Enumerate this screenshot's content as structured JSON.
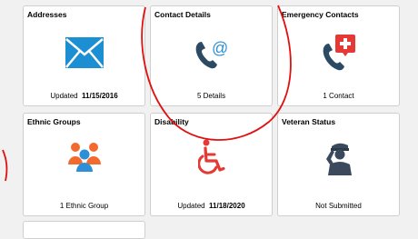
{
  "tiles": [
    {
      "title": "Addresses",
      "status_prefix": "Updated",
      "status_value": "11/15/2016",
      "icon": "envelope-icon"
    },
    {
      "title": "Contact Details",
      "status_prefix": "",
      "status_value": "5 Details",
      "icon": "phone-email-icon"
    },
    {
      "title": "Emergency Contacts",
      "status_prefix": "",
      "status_value": "1 Contact",
      "icon": "phone-medical-icon"
    },
    {
      "title": "Ethnic Groups",
      "status_prefix": "",
      "status_value": "1 Ethnic Group",
      "icon": "people-group-icon"
    },
    {
      "title": "Disability",
      "status_prefix": "Updated",
      "status_value": "11/18/2020",
      "icon": "wheelchair-icon"
    },
    {
      "title": "Veteran Status",
      "status_prefix": "",
      "status_value": "Not Submitted",
      "icon": "saluting-soldier-icon"
    }
  ],
  "colors": {
    "envelope": "#1b8fd2",
    "phone": "#2c4a63",
    "medical": "#e53935",
    "wheelchair": "#e53935",
    "people_orange": "#f26a2e",
    "people_blue": "#2d8fd5",
    "annotation": "#e01010"
  }
}
